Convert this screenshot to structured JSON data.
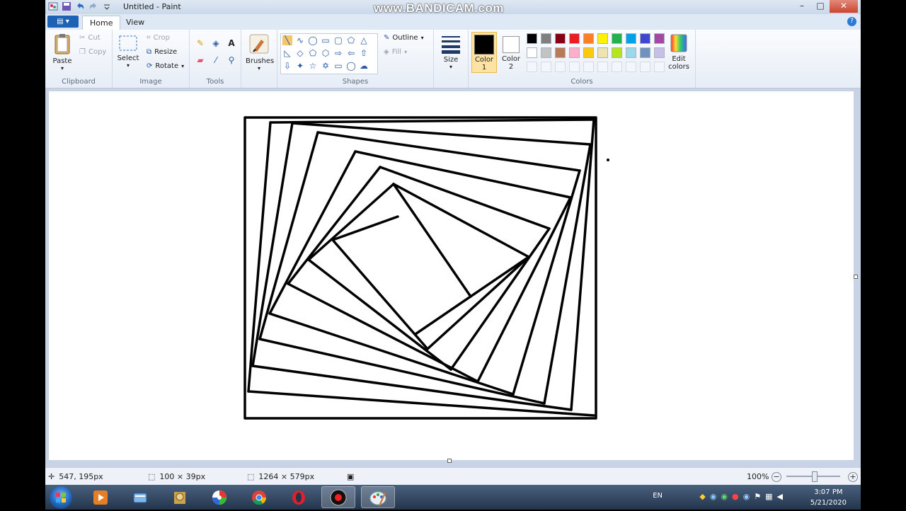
{
  "window": {
    "title": "Untitled - Paint",
    "watermark": "www.BANDICAM.com",
    "controls": {
      "minimize": "–",
      "maximize": "□",
      "close": "✕"
    }
  },
  "tabs": {
    "file": "▤ ▾",
    "home": "Home",
    "view": "View",
    "help": "?"
  },
  "clipboard": {
    "paste": "Paste",
    "cut": "Cut",
    "copy": "Copy",
    "label": "Clipboard"
  },
  "image": {
    "select": "Select",
    "crop": "Crop",
    "resize": "Resize",
    "rotate": "Rotate",
    "label": "Image"
  },
  "tools": {
    "label": "Tools",
    "text_tool": "A"
  },
  "brushes": {
    "label": "Brushes"
  },
  "shapes": {
    "outline": "Outline",
    "fill": "Fill",
    "label": "Shapes"
  },
  "size": {
    "label": "Size"
  },
  "colors": {
    "color1": "Color",
    "color1_num": "1",
    "color2": "Color",
    "color2_num": "2",
    "edit": "Edit",
    "edit2": "colors",
    "label": "Colors",
    "color1_value": "#000000",
    "color2_value": "#ffffff",
    "palette_row1": [
      "#000000",
      "#7f7f7f",
      "#880015",
      "#ed1c24",
      "#ff7f27",
      "#fff200",
      "#22b14c",
      "#00a2e8",
      "#3f48cc",
      "#a349a4"
    ],
    "palette_row2": [
      "#ffffff",
      "#c3c3c3",
      "#b97a57",
      "#ffaec9",
      "#ffc90e",
      "#efe4b0",
      "#b5e61d",
      "#99d9ea",
      "#7092be",
      "#c8bfe7"
    ]
  },
  "status": {
    "cursor_pos": "547, 195px",
    "selection_size": "100 × 39px",
    "canvas_size": "1264 × 579px",
    "zoom": "100%",
    "zoom_minus": "−",
    "zoom_plus": "+"
  },
  "taskbar": {
    "lang": "EN",
    "time": "3:07 PM",
    "date": "5/21/2020"
  }
}
